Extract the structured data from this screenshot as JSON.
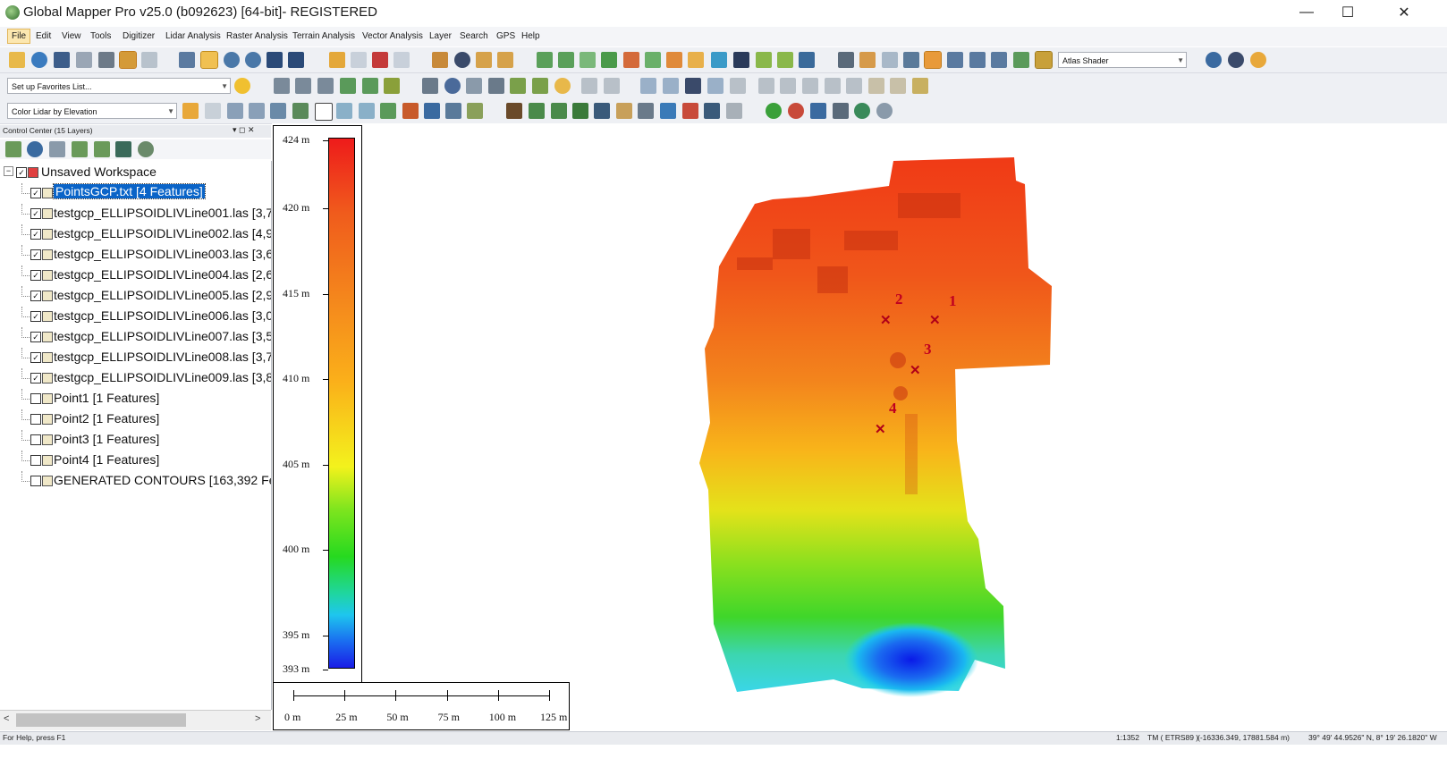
{
  "window": {
    "title": "Global Mapper Pro v25.0 (b092623) [64-bit]- REGISTERED",
    "controls": {
      "minimize": "—",
      "maximize": "☐",
      "close": "✕"
    }
  },
  "menu": [
    "File",
    "Edit",
    "View",
    "Tools",
    "Digitizer",
    "Lidar Analysis",
    "Raster Analysis",
    "Terrain Analysis",
    "Vector Analysis",
    "Layer",
    "Search",
    "GPS",
    "Help"
  ],
  "toolbar": {
    "shader_combo": "Atlas Shader",
    "favorites_combo": "Set up Favorites List...",
    "lidar_color_combo": "Color Lidar by Elevation"
  },
  "control_center": {
    "header": "Control Center (15 Layers)",
    "header_buttons": "▾ ◻ ✕",
    "workspace": "Unsaved Workspace",
    "layers": [
      {
        "name": "PointsGCP.txt [4 Features]",
        "checked": true,
        "selected": true
      },
      {
        "name": "testgcp_ELLIPSOIDLIVLine001.las [3,7",
        "checked": true
      },
      {
        "name": "testgcp_ELLIPSOIDLIVLine002.las [4,9",
        "checked": true
      },
      {
        "name": "testgcp_ELLIPSOIDLIVLine003.las [3,6",
        "checked": true
      },
      {
        "name": "testgcp_ELLIPSOIDLIVLine004.las [2,6",
        "checked": true
      },
      {
        "name": "testgcp_ELLIPSOIDLIVLine005.las [2,9",
        "checked": true
      },
      {
        "name": "testgcp_ELLIPSOIDLIVLine006.las [3,0",
        "checked": true
      },
      {
        "name": "testgcp_ELLIPSOIDLIVLine007.las [3,5",
        "checked": true
      },
      {
        "name": "testgcp_ELLIPSOIDLIVLine008.las [3,7",
        "checked": true
      },
      {
        "name": "testgcp_ELLIPSOIDLIVLine009.las [3,8",
        "checked": true
      },
      {
        "name": "Point1 [1 Features]",
        "checked": false
      },
      {
        "name": "Point2 [1 Features]",
        "checked": false
      },
      {
        "name": "Point3 [1 Features]",
        "checked": false
      },
      {
        "name": "Point4 [1 Features]",
        "checked": false
      },
      {
        "name": "GENERATED CONTOURS [163,392 Fe",
        "checked": false
      }
    ]
  },
  "elevation_legend": {
    "ticks": [
      "424 m",
      "420 m",
      "415 m",
      "410 m",
      "405 m",
      "400 m",
      "395 m",
      "393 m"
    ],
    "range_m": [
      393,
      424
    ]
  },
  "scale_bar": {
    "labels": [
      "0 m",
      "25 m",
      "50 m",
      "75 m",
      "100 m",
      "125 m"
    ]
  },
  "gcp_labels": [
    "1",
    "2",
    "3",
    "4"
  ],
  "status": {
    "help": "For Help, press F1",
    "scale": "1:1352",
    "projection": "TM ( ETRS89 )",
    "coords": "(-16336.349, 17881.584 m)",
    "geo": "39° 49' 44.9526\" N, 8° 19' 26.1820\" W"
  },
  "colors": {
    "selection": "#0a64c8",
    "gcp": "#c00020"
  }
}
